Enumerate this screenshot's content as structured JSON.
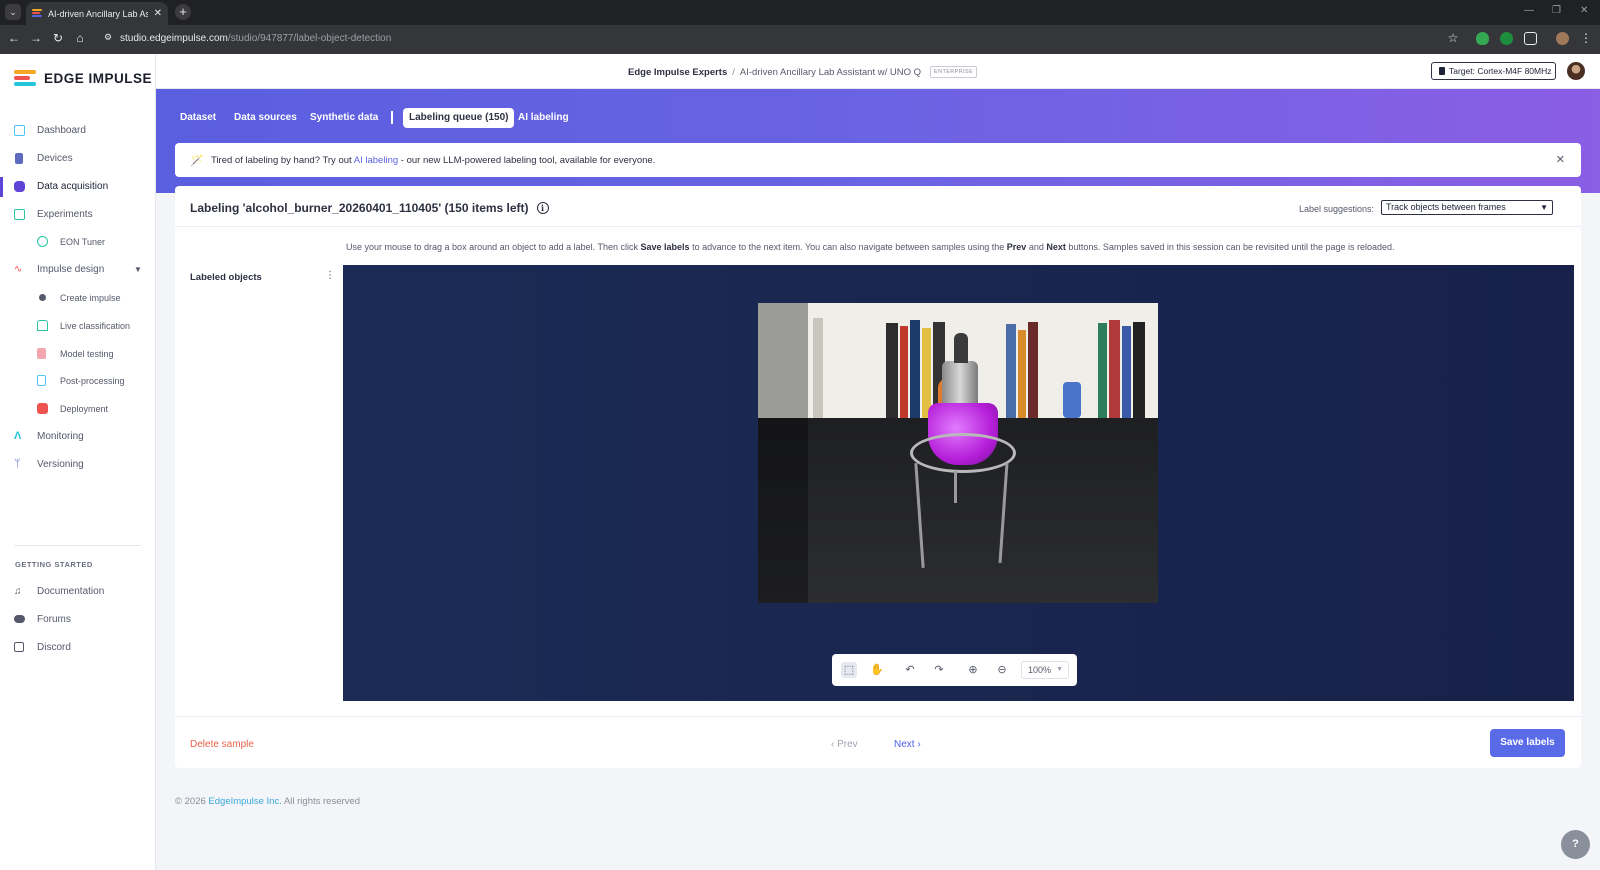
{
  "browser": {
    "tab_title": "AI-driven Ancillary Lab Assistant",
    "tab_close": "✕",
    "new_tab": "+",
    "url_host": "studio.edgeimpulse.com",
    "url_path": "/studio/947877/label-object-detection"
  },
  "app": {
    "logo_text": "EDGE IMPULSE",
    "org": "Edge Impulse Experts",
    "crumb_sep": "/",
    "project": "AI-driven Ancillary Lab Assistant w/ UNO Q",
    "project_badge": "ENTERPRISE",
    "target": "Target: Cortex-M4F 80MHz"
  },
  "sidebar": {
    "items": [
      {
        "label": "Dashboard",
        "icon": "monitor-icon",
        "color": "#4fc3f7"
      },
      {
        "label": "Devices",
        "icon": "device-icon",
        "color": "#5c6bc0"
      },
      {
        "label": "Data acquisition",
        "icon": "database-icon",
        "color": "#5e45d8"
      },
      {
        "label": "Experiments",
        "icon": "grid-icon",
        "color": "#26c6a0"
      },
      {
        "label": "EON Tuner",
        "icon": "tuner-icon",
        "color": "#26c6a0"
      },
      {
        "label": "Impulse design",
        "icon": "pulse-icon",
        "color": "#ef5350"
      },
      {
        "label": "Create impulse",
        "icon": "dot-icon",
        "color": "#55596b"
      },
      {
        "label": "Live classification",
        "icon": "classification-icon",
        "color": "#26c6a0"
      },
      {
        "label": "Model testing",
        "icon": "testing-icon",
        "color": "#ef9a9a"
      },
      {
        "label": "Post-processing",
        "icon": "postprocessing-icon",
        "color": "#4fc3f7"
      },
      {
        "label": "Deployment",
        "icon": "deployment-icon",
        "color": "#ef5350"
      },
      {
        "label": "Monitoring",
        "icon": "monitoring-icon",
        "color": "#26c6da"
      },
      {
        "label": "Versioning",
        "icon": "versioning-icon",
        "color": "#5c6bc0"
      }
    ],
    "getting_started": "GETTING STARTED",
    "links": [
      {
        "label": "Documentation",
        "icon": "documentation-icon"
      },
      {
        "label": "Forums",
        "icon": "forums-icon"
      },
      {
        "label": "Discord",
        "icon": "discord-icon"
      }
    ]
  },
  "subtabs": {
    "dataset": "Dataset",
    "data_sources": "Data sources",
    "synthetic": "Synthetic data",
    "labeling_queue": "Labeling queue (150)",
    "ai_labeling": "AI labeling"
  },
  "banner": {
    "text_before": "Tired of labeling by hand? Try out ",
    "link": "AI labeling",
    "text_after": " - our new LLM-powered labeling tool, available for everyone.",
    "close": "✕"
  },
  "labeling": {
    "title": "Labeling 'alcohol_burner_20260401_110405' (150 items left)",
    "suggestions_label": "Label suggestions:",
    "suggestions_value": "Track objects between frames",
    "instructions_1": "Use your mouse to drag a box around an object to add a label. Then click ",
    "instructions_save": "Save labels",
    "instructions_2": " to advance to the next item. You can also navigate between samples using the ",
    "instructions_prev": "Prev",
    "instructions_and": " and ",
    "instructions_next": "Next",
    "instructions_3": " buttons. Samples saved in this session can be revisited until the page is reloaded.",
    "labeled_objects": "Labeled objects",
    "zoom": "100%",
    "delete": "Delete sample",
    "prev": "‹  Prev",
    "next": "Next  ›",
    "save": "Save labels"
  },
  "footer": {
    "copyright": "© 2026 ",
    "company": "EdgeImpulse Inc.",
    "rights": " All rights reserved"
  },
  "help": "?"
}
